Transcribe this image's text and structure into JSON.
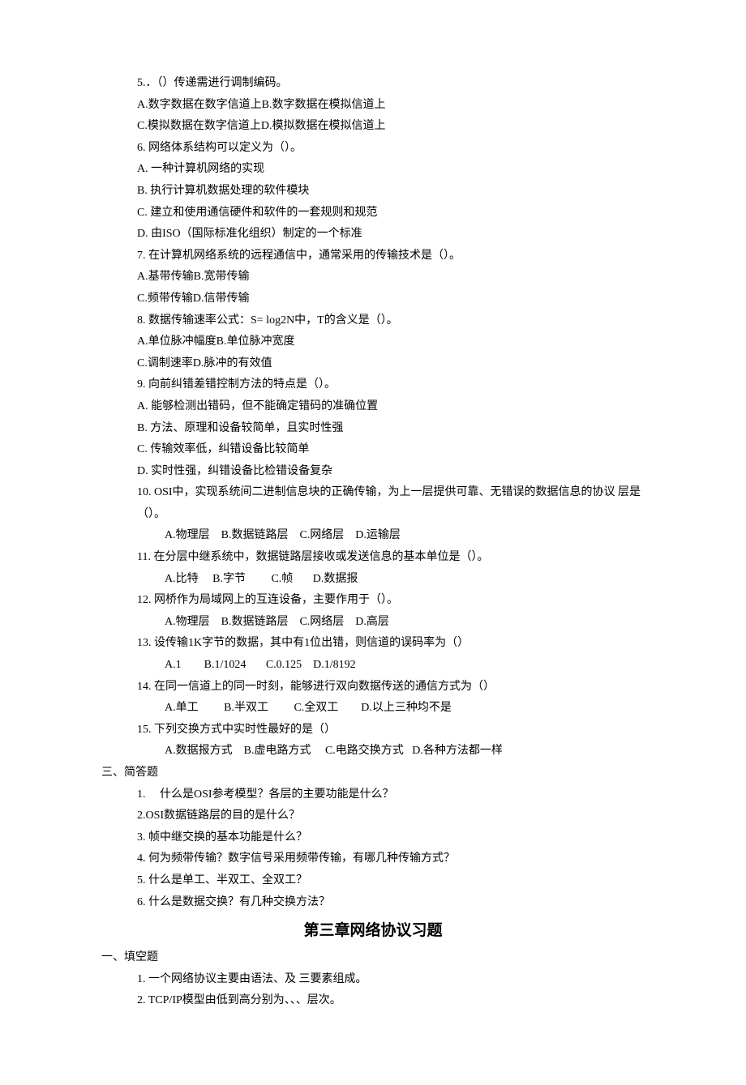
{
  "lines": [
    {
      "cls": "indent1",
      "text": "5.．（）传递需进行调制编码。"
    },
    {
      "cls": "indent1",
      "text": "A.数字数据在数字信道上B.数字数据在模拟信道上"
    },
    {
      "cls": "indent1",
      "text": "C.模拟数据在数字信道上D.模拟数据在模拟信道上"
    },
    {
      "cls": "indent1",
      "text": "6. 网络体系结构可以定义为（）。"
    },
    {
      "cls": "indent1",
      "text": "A. 一种计算机网络的实现"
    },
    {
      "cls": "indent1",
      "text": "B. 执行计算机数据处理的软件模块"
    },
    {
      "cls": "indent1",
      "text": "C. 建立和使用通信硬件和软件的一套规则和规范"
    },
    {
      "cls": "indent1",
      "text": "D. 由ISO（国际标准化组织）制定的一个标准"
    },
    {
      "cls": "indent1",
      "text": "7. 在计算机网络系统的远程通信中，通常采用的传输技术是（）。"
    },
    {
      "cls": "indent1",
      "text": "A.基带传输B.宽带传输"
    },
    {
      "cls": "indent1",
      "text": "C.频带传输D.信带传输"
    },
    {
      "cls": "indent1",
      "text": "8. 数据传输速率公式：S= log2N中，T的含义是（）。"
    },
    {
      "cls": "indent1",
      "text": "A.单位脉冲幅度B.单位脉冲宽度"
    },
    {
      "cls": "indent1",
      "text": "C.调制速率D.脉冲的有效值"
    },
    {
      "cls": "indent1",
      "text": "9. 向前纠错差错控制方法的特点是（）。"
    },
    {
      "cls": "indent1",
      "text": "A. 能够检测出错码，但不能确定错码的准确位置"
    },
    {
      "cls": "indent1",
      "text": "B. 方法、原理和设备较简单，且实时性强"
    },
    {
      "cls": "indent1",
      "text": "C. 传输效率低，纠错设备比较简单"
    },
    {
      "cls": "indent1",
      "text": "D. 实时性强，纠错设备比检错设备复杂"
    },
    {
      "cls": "indent1",
      "text": "10. OSI中，实现系统间二进制信息块的正确传输，为上一层提供可靠、无错误的数据信息的协议 层是（）。"
    },
    {
      "cls": "indent3",
      "text": "A.物理层    B.数据链路层    C.网络层    D.运输层"
    },
    {
      "cls": "indent1",
      "text": "11. 在分层中继系统中，数据链路层接收或发送信息的基本单位是（）。"
    },
    {
      "cls": "indent3",
      "text": "A.比特     B.字节         C.帧       D.数据报"
    },
    {
      "cls": "indent1",
      "text": "12. 网桥作为局域网上的互连设备，主要作用于（）。"
    },
    {
      "cls": "indent3",
      "text": "A.物理层    B.数据链路层    C.网络层    D.高层"
    },
    {
      "cls": "indent1",
      "text": "13. 设传输1K字节的数据，其中有1位出错，则信道的误码率为（）"
    },
    {
      "cls": "indent3",
      "text": "A.1        B.1/1024       C.0.125    D.1/8192"
    },
    {
      "cls": "indent1",
      "text": "14. 在同一信道上的同一时刻，能够进行双向数据传送的通信方式为（）"
    },
    {
      "cls": "indent3",
      "text": "A.单工         B.半双工         C.全双工        D.以上三种均不是"
    },
    {
      "cls": "indent1",
      "text": "15. 下列交换方式中实时性最好的是（）"
    },
    {
      "cls": "indent3",
      "text": "A.数据报方式    B.虚电路方式     C.电路交换方式   D.各种方法都一样"
    },
    {
      "cls": "section-label",
      "text": "三、简答题"
    },
    {
      "cls": "indent1",
      "text": "1.     什么是OSI参考模型？各层的主要功能是什么？"
    },
    {
      "cls": "indent1",
      "text": "2.OSI数据链路层的目的是什么？"
    },
    {
      "cls": "indent1",
      "text": "3. 帧中继交换的基本功能是什么？"
    },
    {
      "cls": "indent1",
      "text": "4. 何为频带传输？数字信号采用频带传输，有哪几种传输方式？"
    },
    {
      "cls": "indent1",
      "text": "5. 什么是单工、半双工、全双工？"
    },
    {
      "cls": "indent1",
      "text": "6. 什么是数据交换？有几种交换方法？"
    }
  ],
  "chapter_title": "第三章网络协议习题",
  "section2": "一、填空题",
  "fill_lines": [
    {
      "cls": "indent1",
      "text": "1. 一个网络协议主要由语法、及 三要素组成。"
    },
    {
      "cls": "indent1",
      "text": "2. TCP/IP模型由低到高分别为、、、层次。"
    }
  ]
}
